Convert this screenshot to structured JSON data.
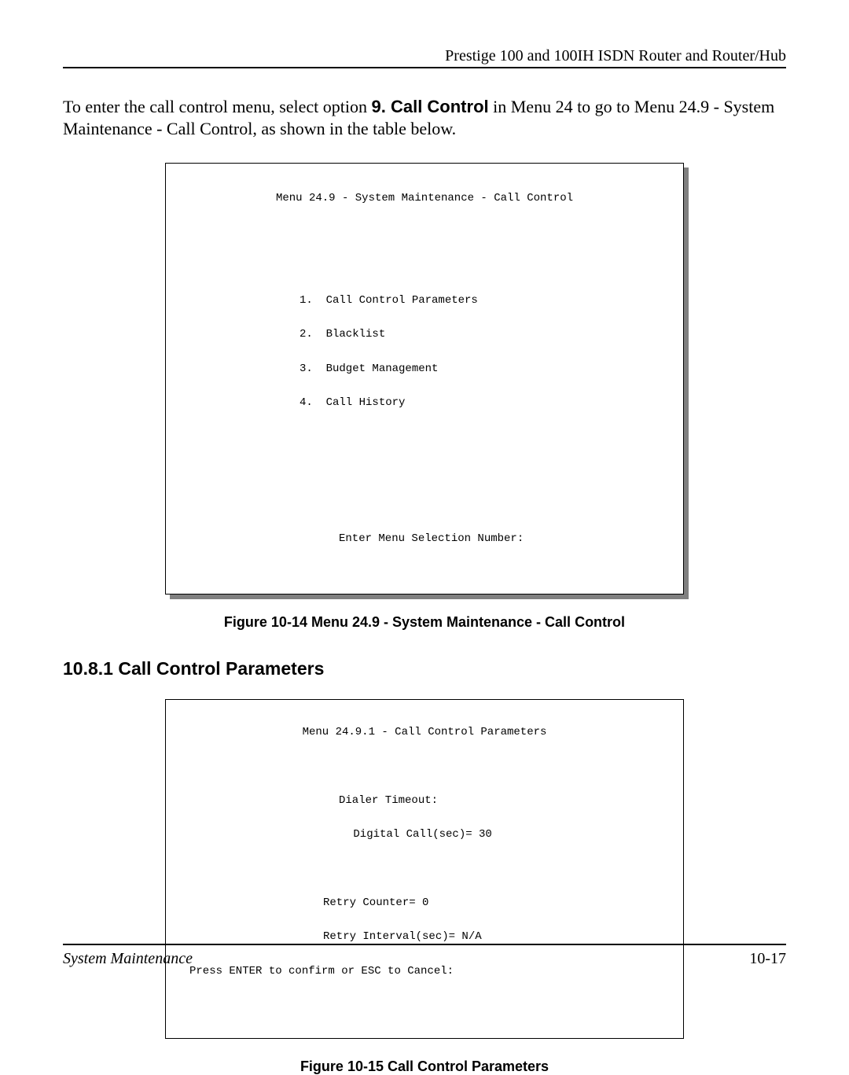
{
  "header": {
    "title": "Prestige 100 and 100IH ISDN Router and Router/Hub"
  },
  "intro": {
    "prefix": "To enter the call control menu, select option ",
    "bold": "9. Call Control",
    "suffix": " in Menu 24 to go to Menu 24.9 - System Maintenance - Call Control, as shown in the table below."
  },
  "menu1": {
    "title": "Menu 24.9 - System Maintenance - Call Control",
    "items": [
      "1.  Call Control Parameters",
      "2.  Blacklist",
      "3.  Budget Management",
      "4.  Call History"
    ],
    "prompt": "Enter Menu Selection Number:"
  },
  "figure1_caption": "Figure 10-14 Menu 24.9 - System Maintenance - Call Control",
  "section_heading": "10.8.1 Call Control Parameters",
  "menu2": {
    "title": "Menu 24.9.1 - Call Control Parameters",
    "line_dialer": "Dialer Timeout:",
    "line_digital": " Digital Call(sec)= 30",
    "line_retry_counter": "Retry Counter= 0",
    "line_retry_interval": "Retry Interval(sec)= N/A",
    "line_press_enter": "Press ENTER to confirm or ESC to Cancel:"
  },
  "figure2_caption": "Figure 10-15 Call Control Parameters",
  "footer": {
    "left": "System Maintenance",
    "right": "10-17"
  }
}
